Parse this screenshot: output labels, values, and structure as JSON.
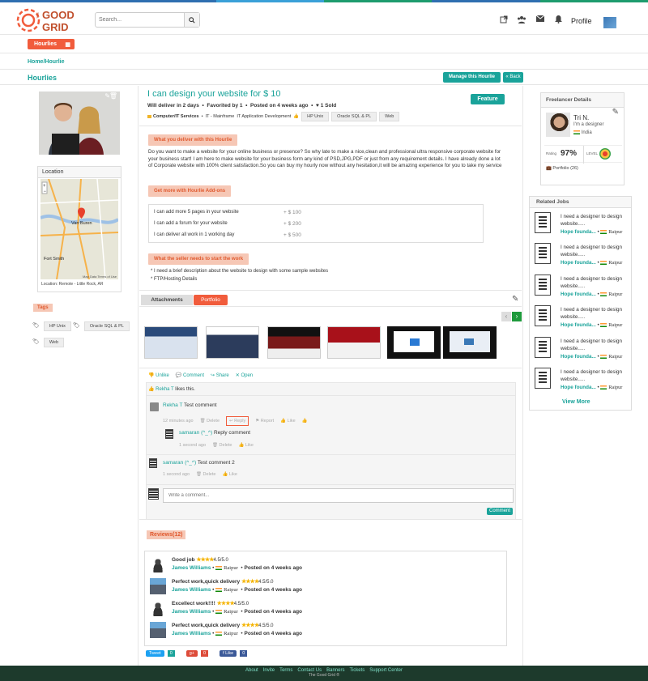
{
  "header": {
    "logo_text": "THE GOOD GRID",
    "search_placeholder": "Search...",
    "profile_label": "Profile"
  },
  "subnav": {
    "hourlies_tab": "Hourlies"
  },
  "breadcrumb": "Home/Hourlie",
  "page_title": "Hourlies",
  "actions": {
    "manage": "Manage this Hourlie",
    "back": "« Back"
  },
  "gig": {
    "title": "I can design your website for $ 10",
    "meta_deliver": "Will deliver in 2 days",
    "meta_favorited": "Favorited by 1",
    "meta_posted": "Posted on 4 weeks ago",
    "meta_sold": "1 Sold",
    "category": "Computer/IT Services",
    "subcategory": "IT - Mainframe",
    "subcategory2": "IT Application Development",
    "chips": [
      "HP Unix",
      "Oracle SQL & PL",
      "Web"
    ],
    "feature_label": "Feature",
    "deliver_btn": "What you deliver with this Hourlie",
    "description": "Do you want to make a website for your online business or presence? So why late to make a nice,clean and professional ultra responsive corporate website for your business start!   I am here to make website for your business form any kind of PSD,JPG,PDF or just from any requirement details. I have already done a lot of Corporate website with 100% client satisfaction.So you can buy my hourly now without any hesitation,it will be amazing experience for you to take my service",
    "addons_btn": "Get more with Hourlie Add-ons",
    "addons": [
      {
        "label": "I can add more 5 pages in your website",
        "price": "+ $  100"
      },
      {
        "label": "I can add a forum for your website",
        "price": "+ $  200"
      },
      {
        "label": "I can deliver all work in 1 working day",
        "price": "+ $  500"
      }
    ],
    "seller_btn": "What the seller needs to start the work",
    "needs": [
      "* I need a brief description about the website to design with some sample websites",
      "* FTP/Hosting Details"
    ]
  },
  "left": {
    "location_title": "Location",
    "location_text": "Location: Remote - Little Rock, AR",
    "map_city1": "Van Buren",
    "map_city2": "Fort Smith",
    "map_credit": "Map Data   Terms of Use",
    "tags_label": "Tags",
    "tags": [
      "HP Unix",
      "Oracle SQL & PL",
      "Web"
    ]
  },
  "tabs": {
    "attachments": "Attachments",
    "portfolio": "Portfolio"
  },
  "social": {
    "unlike": "Unlike",
    "comment": "Comment",
    "share": "Share",
    "open": "Open"
  },
  "likes_line": {
    "name": "Rekha T",
    "rest": "likes this."
  },
  "comments": [
    {
      "author": "Rekha T",
      "text": "Test comment",
      "time": "12 minutes ago",
      "delete": "Delete",
      "reply": "Reply",
      "report": "Report",
      "like": "Like"
    },
    {
      "author": "samaran (^_^)",
      "text": "Reply comment",
      "time": "1 second ago",
      "delete": "Delete",
      "like": "Like"
    },
    {
      "author": "samaran (^_^)",
      "text": "Test comment 2",
      "time": "1 second ago",
      "delete": "Delete",
      "like": "Like"
    }
  ],
  "comment_placeholder": "Write a comment...",
  "comment_btn": "Comment",
  "reviews_label": "Reviews(12)",
  "reviews": [
    {
      "title": "Good job",
      "rating": "4.5/5.0",
      "author": "James Williams",
      "city": "Raipur",
      "posted": "Posted on 4 weeks ago"
    },
    {
      "title": "Perfect work,quick delivery",
      "rating": "4.5/5.0",
      "author": "James Williams",
      "city": "Raipur",
      "posted": "Posted on 4 weeks ago"
    },
    {
      "title": "Excellect work!!!!",
      "rating": "4.5/5.0",
      "author": "James Williams",
      "city": "Raipur",
      "posted": "Posted on 4 weeks ago"
    },
    {
      "title": "Perfect work,quick delivery",
      "rating": "4.5/5.0",
      "author": "James Williams",
      "city": "Raipur",
      "posted": "Posted on 4 weeks ago"
    }
  ],
  "share": {
    "tweet": "Tweet",
    "tweet_count": "0",
    "gplus": "g+",
    "gplus_count": "0",
    "fb": "f Like",
    "fb_count": "0"
  },
  "freelancer": {
    "title": "Freelancer Details",
    "name": "Tri N.",
    "tagline": "I'm a designer",
    "country": "India",
    "rating_label": "Rating",
    "rating": "97%",
    "level": "LEVEL",
    "portfolio": "Portfolio (26)"
  },
  "related": {
    "title": "Related  Jobs",
    "jobs": [
      {
        "title": "I need a designer to design website.....",
        "org": "Hope founda...",
        "city": "Raipur"
      },
      {
        "title": "I need a designer to design website.....",
        "org": "Hope founda...",
        "city": "Raipur"
      },
      {
        "title": "I need a designer to design website.....",
        "org": "Hope founda...",
        "city": "Raipur"
      },
      {
        "title": "I need a designer to design website.....",
        "org": "Hope founda...",
        "city": "Raipur"
      },
      {
        "title": "I need a designer to design website.....",
        "org": "Hope founda...",
        "city": "Raipur"
      },
      {
        "title": "I need a designer to design website.....",
        "org": "Hope founda...",
        "city": "Raipur"
      }
    ],
    "view_more": "View More"
  },
  "footer": {
    "links": [
      "About",
      "Invite",
      "Terms",
      "Contact Us",
      "Banners",
      "Tickets",
      "Support Center"
    ],
    "copyright": "The Good Grid ®"
  },
  "colors": {
    "accent": "#1aa39a",
    "orange": "#f15c3c",
    "footer_bg": "#1d3a2c"
  }
}
